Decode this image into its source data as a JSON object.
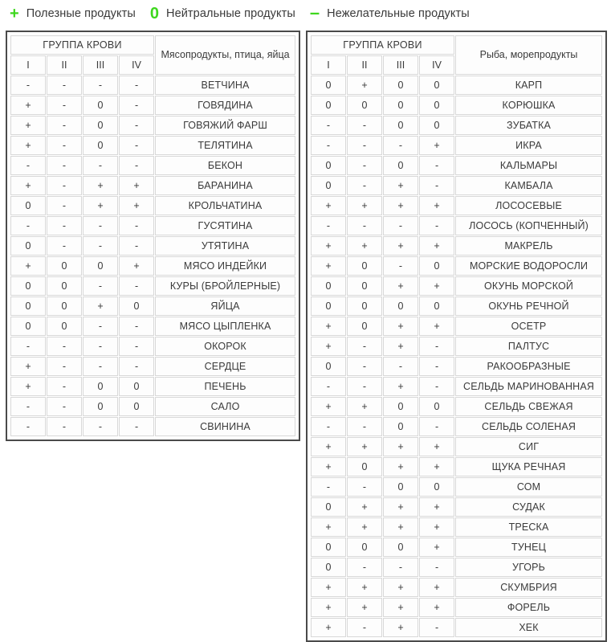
{
  "legend": {
    "items": [
      {
        "symbol": "+",
        "icon": "plus-icon",
        "label": "Полезные продукты"
      },
      {
        "symbol": "0",
        "icon": "zero-icon",
        "label": "Нейтральные продукты"
      },
      {
        "symbol": "–",
        "icon": "minus-icon",
        "label": "Нежелательные продукты"
      }
    ],
    "accent_color": "#3ed71e"
  },
  "colors": {
    "blood_1": "#faeeda",
    "blood_2": "#fbfbfb",
    "blood_3": "#fbf7a4",
    "blood_4": "#e87fe8",
    "frame": "#4a4a4a",
    "cell_border": "#d8d8d8"
  },
  "tables": [
    {
      "id": "meat-table",
      "group_header": "ГРУППА КРОВИ",
      "blood_groups": [
        "I",
        "II",
        "III",
        "IV"
      ],
      "product_header": "Мясопродукты, птица, яйца",
      "rows": [
        {
          "name": "ВЕТЧИНА",
          "marks": [
            "-",
            "-",
            "-",
            "-"
          ]
        },
        {
          "name": "ГОВЯДИНА",
          "marks": [
            "+",
            "-",
            "0",
            "-"
          ]
        },
        {
          "name": "ГОВЯЖИЙ ФАРШ",
          "marks": [
            "+",
            "-",
            "0",
            "-"
          ]
        },
        {
          "name": "ТЕЛЯТИНА",
          "marks": [
            "+",
            "-",
            "0",
            "-"
          ]
        },
        {
          "name": "БЕКОН",
          "marks": [
            "-",
            "-",
            "-",
            "-"
          ]
        },
        {
          "name": "БАРАНИНА",
          "marks": [
            "+",
            "-",
            "+",
            "+"
          ]
        },
        {
          "name": "КРОЛЬЧАТИНА",
          "marks": [
            "0",
            "-",
            "+",
            "+"
          ]
        },
        {
          "name": "ГУСЯТИНА",
          "marks": [
            "-",
            "-",
            "-",
            "-"
          ]
        },
        {
          "name": "УТЯТИНА",
          "marks": [
            "0",
            "-",
            "-",
            "-"
          ]
        },
        {
          "name": "МЯСО ИНДЕЙКИ",
          "marks": [
            "+",
            "0",
            "0",
            "+"
          ]
        },
        {
          "name": "КУРЫ (БРОЙЛЕРНЫЕ)",
          "marks": [
            "0",
            "0",
            "-",
            "-"
          ]
        },
        {
          "name": "ЯЙЦА",
          "marks": [
            "0",
            "0",
            "+",
            "0"
          ]
        },
        {
          "name": "МЯСО ЦЫПЛЕНКА",
          "marks": [
            "0",
            "0",
            "-",
            "-"
          ]
        },
        {
          "name": "ОКОРОК",
          "marks": [
            "-",
            "-",
            "-",
            "-"
          ]
        },
        {
          "name": "СЕРДЦЕ",
          "marks": [
            "+",
            "-",
            "-",
            "-"
          ]
        },
        {
          "name": "ПЕЧЕНЬ",
          "marks": [
            "+",
            "-",
            "0",
            "0"
          ]
        },
        {
          "name": "САЛО",
          "marks": [
            "-",
            "-",
            "0",
            "0"
          ]
        },
        {
          "name": "СВИНИНА",
          "marks": [
            "-",
            "-",
            "-",
            "-"
          ]
        }
      ]
    },
    {
      "id": "fish-table",
      "group_header": "ГРУППА КРОВИ",
      "blood_groups": [
        "I",
        "II",
        "III",
        "IV"
      ],
      "product_header": "Рыба, морепродукты",
      "rows": [
        {
          "name": "КАРП",
          "marks": [
            "0",
            "+",
            "0",
            "0"
          ]
        },
        {
          "name": "КОРЮШКА",
          "marks": [
            "0",
            "0",
            "0",
            "0"
          ]
        },
        {
          "name": "ЗУБАТКА",
          "marks": [
            "-",
            "-",
            "0",
            "0"
          ]
        },
        {
          "name": "ИКРА",
          "marks": [
            "-",
            "-",
            "-",
            "+"
          ]
        },
        {
          "name": "КАЛЬМАРЫ",
          "marks": [
            "0",
            "-",
            "0",
            "-"
          ]
        },
        {
          "name": "КАМБАЛА",
          "marks": [
            "0",
            "-",
            "+",
            "-"
          ]
        },
        {
          "name": "ЛОСОСЕВЫЕ",
          "marks": [
            "+",
            "+",
            "+",
            "+"
          ]
        },
        {
          "name": "ЛОСОСЬ (КОПЧЕННЫЙ)",
          "marks": [
            "-",
            "-",
            "-",
            "-"
          ]
        },
        {
          "name": "МАКРЕЛЬ",
          "marks": [
            "+",
            "+",
            "+",
            "+"
          ]
        },
        {
          "name": "МОРСКИЕ ВОДОРОСЛИ",
          "marks": [
            "+",
            "0",
            "-",
            "0"
          ]
        },
        {
          "name": "ОКУНЬ МОРСКОЙ",
          "marks": [
            "0",
            "0",
            "+",
            "+"
          ]
        },
        {
          "name": "ОКУНЬ РЕЧНОЙ",
          "marks": [
            "0",
            "0",
            "0",
            "0"
          ]
        },
        {
          "name": "ОСЕТР",
          "marks": [
            "+",
            "0",
            "+",
            "+"
          ]
        },
        {
          "name": "ПАЛТУС",
          "marks": [
            "+",
            "-",
            "+",
            "-"
          ]
        },
        {
          "name": "РАКООБРАЗНЫЕ",
          "marks": [
            "0",
            "-",
            "-",
            "-"
          ]
        },
        {
          "name": "СЕЛЬДЬ МАРИНОВАННАЯ",
          "marks": [
            "-",
            "-",
            "+",
            "-"
          ]
        },
        {
          "name": "СЕЛЬДЬ СВЕЖАЯ",
          "marks": [
            "+",
            "+",
            "0",
            "0"
          ]
        },
        {
          "name": "СЕЛЬДЬ СОЛЕНАЯ",
          "marks": [
            "-",
            "-",
            "0",
            "-"
          ]
        },
        {
          "name": "СИГ",
          "marks": [
            "+",
            "+",
            "+",
            "+"
          ]
        },
        {
          "name": "ЩУКА РЕЧНАЯ",
          "marks": [
            "+",
            "0",
            "+",
            "+"
          ]
        },
        {
          "name": "СОМ",
          "marks": [
            "-",
            "-",
            "0",
            "0"
          ]
        },
        {
          "name": "СУДАК",
          "marks": [
            "0",
            "+",
            "+",
            "+"
          ]
        },
        {
          "name": "ТРЕСКА",
          "marks": [
            "+",
            "+",
            "+",
            "+"
          ]
        },
        {
          "name": "ТУНЕЦ",
          "marks": [
            "0",
            "0",
            "0",
            "+"
          ]
        },
        {
          "name": "УГОРЬ",
          "marks": [
            "0",
            "-",
            "-",
            "-"
          ]
        },
        {
          "name": "СКУМБРИЯ",
          "marks": [
            "+",
            "+",
            "+",
            "+"
          ]
        },
        {
          "name": "ФОРЕЛЬ",
          "marks": [
            "+",
            "+",
            "+",
            "+"
          ]
        },
        {
          "name": "ХЕК",
          "marks": [
            "+",
            "-",
            "+",
            "-"
          ]
        }
      ]
    }
  ]
}
